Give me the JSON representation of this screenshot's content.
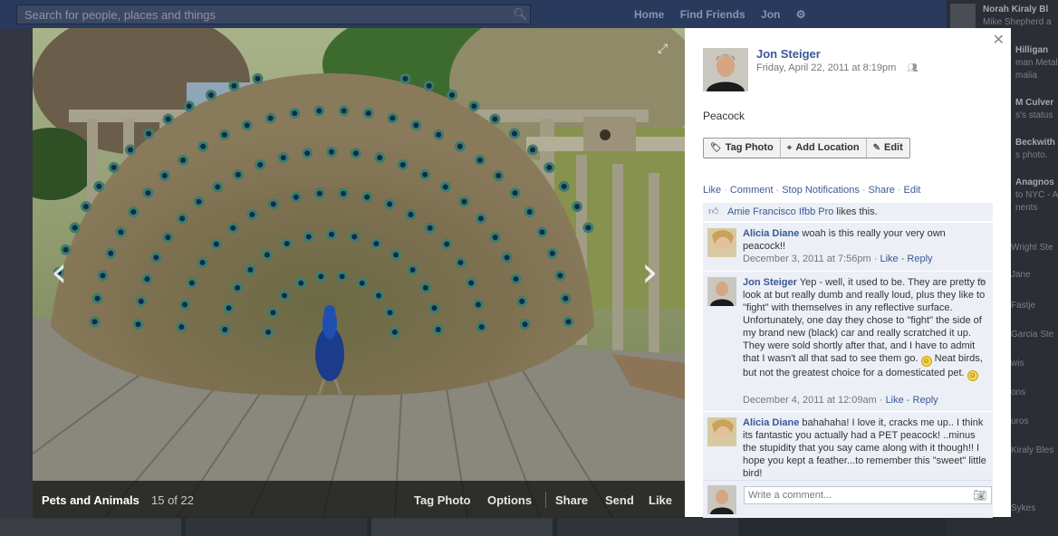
{
  "background": {
    "search_placeholder": "Search for people, places and things",
    "nav": [
      "Home",
      "Find Friends",
      "Jon"
    ],
    "ticker": [
      {
        "name": "Norah Kiraly Bl",
        "text": "Mike Shepherd a"
      },
      {
        "name": "Hilligan",
        "text": "man Metal"
      },
      {
        "name": "",
        "text": "malia"
      },
      {
        "name": "M Culver",
        "text": "s's status"
      },
      {
        "name": "Beckwith",
        "text": "s photo."
      },
      {
        "name": "Anagnos",
        "text": "to NYC - A"
      },
      {
        "name": "",
        "text": "nents"
      }
    ],
    "ticker_left": [
      "Wright Ste",
      "Jane",
      "Fastje",
      "Garcia Ste",
      "wis",
      "ons",
      "uros",
      "Kiraly Bles",
      "Sykes"
    ]
  },
  "photo": {
    "album": "Pets and Animals",
    "count": "15 of 22",
    "actions": [
      "Tag Photo",
      "Options",
      "Share",
      "Send",
      "Like"
    ]
  },
  "panel": {
    "author": "Jon Steiger",
    "date": "Friday, April 22, 2011 at 8:19pm",
    "caption": "Peacock",
    "buttons": [
      {
        "label": "Tag Photo",
        "icon": "tag-icon"
      },
      {
        "label": "Add Location",
        "icon": "location-pin-icon"
      },
      {
        "label": "Edit",
        "icon": "pencil-icon"
      }
    ],
    "actions": [
      "Like",
      "Comment",
      "Stop Notifications",
      "Share",
      "Edit"
    ],
    "likes": {
      "name": "Amie Francisco Ifbb Pro",
      "suffix": " likes this."
    },
    "comments": [
      {
        "name": "Alicia Diane",
        "text": "woah is this really your very own peacock!!",
        "time": "December 3, 2011 at 7:56pm",
        "like": "Like",
        "reply": "Reply"
      },
      {
        "name": "Jon Steiger",
        "text": "Yep - well, it used to be. They are pretty to look at but really dumb and really loud, plus they like to \"fight\" with themselves in any reflective surface. Unfortunately, one day they chose to \"fight\" the side of my brand new (black) car and really scratched it up. They were sold shortly after that, and I have to admit that I wasn't all that sad to see them go.",
        "text2": "Neat birds, but not the greatest choice for a domesticated pet.",
        "time": "December 4, 2011 at 12:09am",
        "like": "Like",
        "reply": "Reply"
      },
      {
        "name": "Alicia Diane",
        "text": "bahahaha! I love it, cracks me up.. I think its fantastic you actually had a PET peacock! ..minus the stupidity that you say came along with it though!! I hope you kept a feather...to remember this \"sweet\" little bird!"
      }
    ],
    "write_placeholder": "Write a comment..."
  }
}
